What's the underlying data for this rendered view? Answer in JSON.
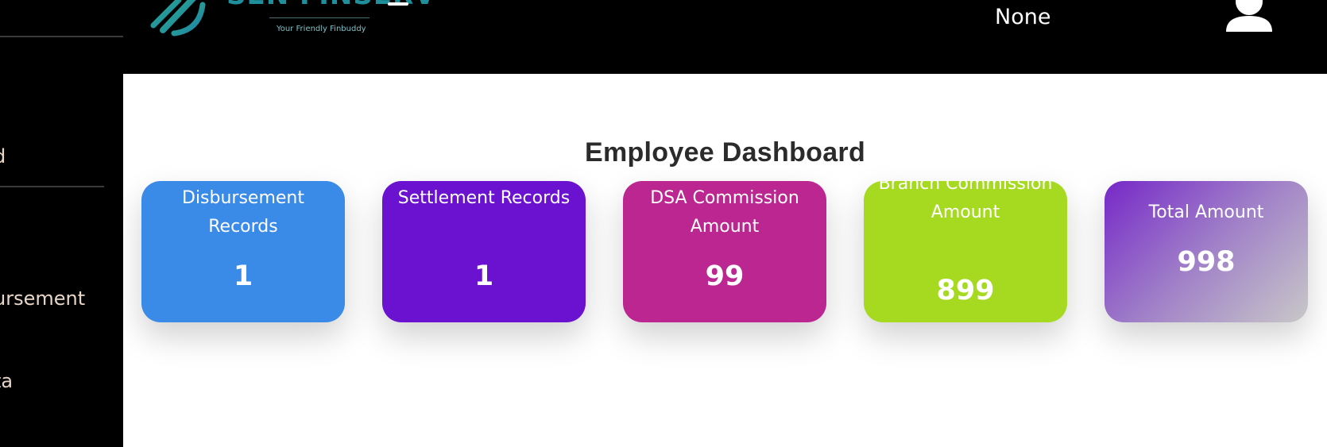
{
  "sidebar": {
    "items": [
      {
        "label": "d"
      },
      {
        "label": "ursement"
      },
      {
        "label": "ta"
      }
    ]
  },
  "header": {
    "logo_text": "SEN FINSERV",
    "tagline": "Your Friendly Finbuddy",
    "user_name": "None",
    "menu_icon": "hamburger-icon",
    "avatar_icon": "user-icon"
  },
  "main": {
    "title": "Employee Dashboard",
    "cards": [
      {
        "label": "Disbursement Records",
        "value": "1",
        "color": "#3a8ae8"
      },
      {
        "label": "Settlement Records",
        "value": "1",
        "color": "#6a12d0"
      },
      {
        "label": "DSA Commission Amount",
        "value": "99",
        "color": "#bc2690"
      },
      {
        "label": "Branch Commission Amount",
        "value": "899",
        "color": "#a6da20"
      },
      {
        "label": "Total Amount",
        "value": "998",
        "color": "#7628c8"
      }
    ]
  }
}
